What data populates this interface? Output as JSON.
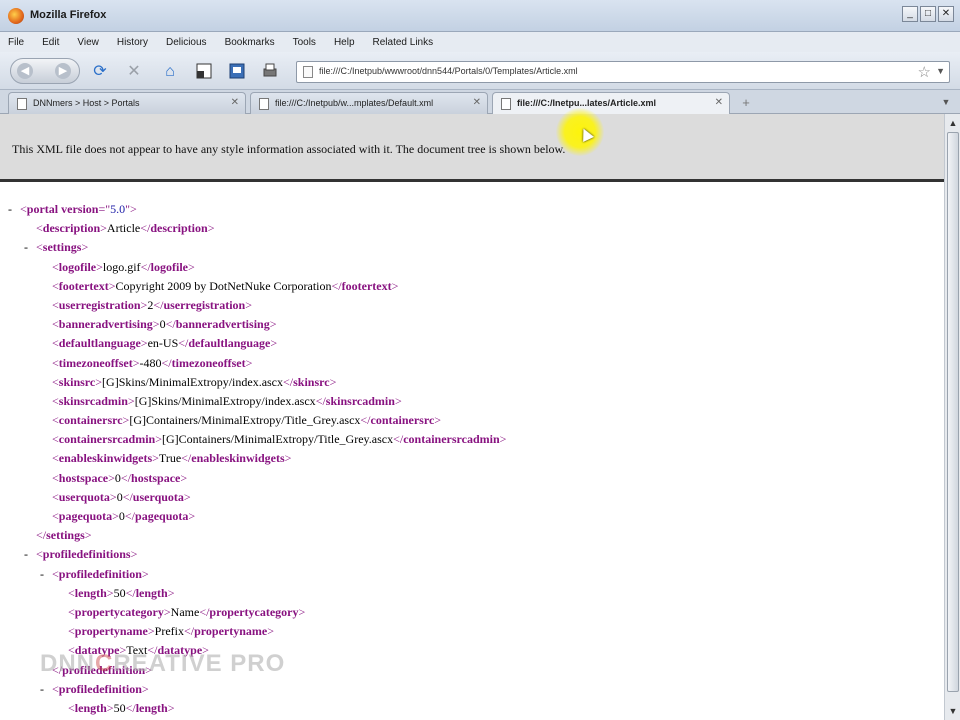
{
  "window": {
    "title": "Mozilla Firefox",
    "buttons": [
      "_",
      "□",
      "✕"
    ]
  },
  "menu": [
    "File",
    "Edit",
    "View",
    "History",
    "Delicious",
    "Bookmarks",
    "Tools",
    "Help",
    "Related Links"
  ],
  "toolbar": {
    "icons": [
      "back-forward-icon",
      "reload-icon",
      "stop-icon",
      "home-icon",
      "page-icon",
      "bookmark-icon",
      "print-icon"
    ],
    "url": "file:///C:/Inetpub/wwwroot/dnn544/Portals/0/Templates/Article.xml"
  },
  "tabs": [
    {
      "label": "DNNmers > Host > Portals",
      "active": false
    },
    {
      "label": "file:///C:/Inetpub/w...mplates/Default.xml",
      "active": false
    },
    {
      "label": "file:///C:/Inetpu...lates/Article.xml",
      "active": true
    }
  ],
  "info_message": "This XML file does not appear to have any style information associated with it. The document tree is shown below.",
  "xml_lines": [
    {
      "indent": 0,
      "toggle": "-",
      "parts": [
        [
          "bracket",
          "<"
        ],
        [
          "tag",
          "portal"
        ],
        [
          "txt",
          " "
        ],
        [
          "attr-name",
          "version"
        ],
        [
          "bracket",
          "=\""
        ],
        [
          "attr-val",
          "5.0"
        ],
        [
          "bracket",
          "\">"
        ]
      ]
    },
    {
      "indent": 1,
      "toggle": "",
      "parts": [
        [
          "bracket",
          "<"
        ],
        [
          "tag",
          "description"
        ],
        [
          "bracket",
          ">"
        ],
        [
          "txt",
          "Article"
        ],
        [
          "bracket",
          "</"
        ],
        [
          "tag",
          "description"
        ],
        [
          "bracket",
          ">"
        ]
      ]
    },
    {
      "indent": 1,
      "toggle": "-",
      "parts": [
        [
          "bracket",
          "<"
        ],
        [
          "tag",
          "settings"
        ],
        [
          "bracket",
          ">"
        ]
      ]
    },
    {
      "indent": 2,
      "toggle": "",
      "parts": [
        [
          "bracket",
          "<"
        ],
        [
          "tag",
          "logofile"
        ],
        [
          "bracket",
          ">"
        ],
        [
          "txt",
          "logo.gif"
        ],
        [
          "bracket",
          "</"
        ],
        [
          "tag",
          "logofile"
        ],
        [
          "bracket",
          ">"
        ]
      ]
    },
    {
      "indent": 2,
      "toggle": "",
      "parts": [
        [
          "bracket",
          "<"
        ],
        [
          "tag",
          "footertext"
        ],
        [
          "bracket",
          ">"
        ],
        [
          "txt",
          "Copyright 2009 by DotNetNuke Corporation"
        ],
        [
          "bracket",
          "</"
        ],
        [
          "tag",
          "footertext"
        ],
        [
          "bracket",
          ">"
        ]
      ]
    },
    {
      "indent": 2,
      "toggle": "",
      "parts": [
        [
          "bracket",
          "<"
        ],
        [
          "tag",
          "userregistration"
        ],
        [
          "bracket",
          ">"
        ],
        [
          "txt",
          "2"
        ],
        [
          "bracket",
          "</"
        ],
        [
          "tag",
          "userregistration"
        ],
        [
          "bracket",
          ">"
        ]
      ]
    },
    {
      "indent": 2,
      "toggle": "",
      "parts": [
        [
          "bracket",
          "<"
        ],
        [
          "tag",
          "banneradvertising"
        ],
        [
          "bracket",
          ">"
        ],
        [
          "txt",
          "0"
        ],
        [
          "bracket",
          "</"
        ],
        [
          "tag",
          "banneradvertising"
        ],
        [
          "bracket",
          ">"
        ]
      ]
    },
    {
      "indent": 2,
      "toggle": "",
      "parts": [
        [
          "bracket",
          "<"
        ],
        [
          "tag",
          "defaultlanguage"
        ],
        [
          "bracket",
          ">"
        ],
        [
          "txt",
          "en-US"
        ],
        [
          "bracket",
          "</"
        ],
        [
          "tag",
          "defaultlanguage"
        ],
        [
          "bracket",
          ">"
        ]
      ]
    },
    {
      "indent": 2,
      "toggle": "",
      "parts": [
        [
          "bracket",
          "<"
        ],
        [
          "tag",
          "timezoneoffset"
        ],
        [
          "bracket",
          ">"
        ],
        [
          "txt",
          "-480"
        ],
        [
          "bracket",
          "</"
        ],
        [
          "tag",
          "timezoneoffset"
        ],
        [
          "bracket",
          ">"
        ]
      ]
    },
    {
      "indent": 2,
      "toggle": "",
      "parts": [
        [
          "bracket",
          "<"
        ],
        [
          "tag",
          "skinsrc"
        ],
        [
          "bracket",
          ">"
        ],
        [
          "txt",
          "[G]Skins/MinimalExtropy/index.ascx"
        ],
        [
          "bracket",
          "</"
        ],
        [
          "tag",
          "skinsrc"
        ],
        [
          "bracket",
          ">"
        ]
      ]
    },
    {
      "indent": 2,
      "toggle": "",
      "parts": [
        [
          "bracket",
          "<"
        ],
        [
          "tag",
          "skinsrcadmin"
        ],
        [
          "bracket",
          ">"
        ],
        [
          "txt",
          "[G]Skins/MinimalExtropy/index.ascx"
        ],
        [
          "bracket",
          "</"
        ],
        [
          "tag",
          "skinsrcadmin"
        ],
        [
          "bracket",
          ">"
        ]
      ]
    },
    {
      "indent": 2,
      "toggle": "",
      "parts": [
        [
          "bracket",
          "<"
        ],
        [
          "tag",
          "containersrc"
        ],
        [
          "bracket",
          ">"
        ],
        [
          "txt",
          "[G]Containers/MinimalExtropy/Title_Grey.ascx"
        ],
        [
          "bracket",
          "</"
        ],
        [
          "tag",
          "containersrc"
        ],
        [
          "bracket",
          ">"
        ]
      ]
    },
    {
      "indent": 2,
      "toggle": "",
      "parts": [
        [
          "bracket",
          "<"
        ],
        [
          "tag",
          "containersrcadmin"
        ],
        [
          "bracket",
          ">"
        ],
        [
          "txt",
          "[G]Containers/MinimalExtropy/Title_Grey.ascx"
        ],
        [
          "bracket",
          "</"
        ],
        [
          "tag",
          "containersrcadmin"
        ],
        [
          "bracket",
          ">"
        ]
      ]
    },
    {
      "indent": 2,
      "toggle": "",
      "parts": [
        [
          "bracket",
          "<"
        ],
        [
          "tag",
          "enableskinwidgets"
        ],
        [
          "bracket",
          ">"
        ],
        [
          "txt",
          "True"
        ],
        [
          "bracket",
          "</"
        ],
        [
          "tag",
          "enableskinwidgets"
        ],
        [
          "bracket",
          ">"
        ]
      ]
    },
    {
      "indent": 2,
      "toggle": "",
      "parts": [
        [
          "bracket",
          "<"
        ],
        [
          "tag",
          "hostspace"
        ],
        [
          "bracket",
          ">"
        ],
        [
          "txt",
          "0"
        ],
        [
          "bracket",
          "</"
        ],
        [
          "tag",
          "hostspace"
        ],
        [
          "bracket",
          ">"
        ]
      ]
    },
    {
      "indent": 2,
      "toggle": "",
      "parts": [
        [
          "bracket",
          "<"
        ],
        [
          "tag",
          "userquota"
        ],
        [
          "bracket",
          ">"
        ],
        [
          "txt",
          "0"
        ],
        [
          "bracket",
          "</"
        ],
        [
          "tag",
          "userquota"
        ],
        [
          "bracket",
          ">"
        ]
      ]
    },
    {
      "indent": 2,
      "toggle": "",
      "parts": [
        [
          "bracket",
          "<"
        ],
        [
          "tag",
          "pagequota"
        ],
        [
          "bracket",
          ">"
        ],
        [
          "txt",
          "0"
        ],
        [
          "bracket",
          "</"
        ],
        [
          "tag",
          "pagequota"
        ],
        [
          "bracket",
          ">"
        ]
      ]
    },
    {
      "indent": 1,
      "toggle": "",
      "parts": [
        [
          "bracket",
          "</"
        ],
        [
          "tag",
          "settings"
        ],
        [
          "bracket",
          ">"
        ]
      ]
    },
    {
      "indent": 1,
      "toggle": "-",
      "parts": [
        [
          "bracket",
          "<"
        ],
        [
          "tag",
          "profiledefinitions"
        ],
        [
          "bracket",
          ">"
        ]
      ]
    },
    {
      "indent": 2,
      "toggle": "-",
      "parts": [
        [
          "bracket",
          "<"
        ],
        [
          "tag",
          "profiledefinition"
        ],
        [
          "bracket",
          ">"
        ]
      ]
    },
    {
      "indent": 3,
      "toggle": "",
      "parts": [
        [
          "bracket",
          "<"
        ],
        [
          "tag",
          "length"
        ],
        [
          "bracket",
          ">"
        ],
        [
          "txt",
          "50"
        ],
        [
          "bracket",
          "</"
        ],
        [
          "tag",
          "length"
        ],
        [
          "bracket",
          ">"
        ]
      ]
    },
    {
      "indent": 3,
      "toggle": "",
      "parts": [
        [
          "bracket",
          "<"
        ],
        [
          "tag",
          "propertycategory"
        ],
        [
          "bracket",
          ">"
        ],
        [
          "txt",
          "Name"
        ],
        [
          "bracket",
          "</"
        ],
        [
          "tag",
          "propertycategory"
        ],
        [
          "bracket",
          ">"
        ]
      ]
    },
    {
      "indent": 3,
      "toggle": "",
      "parts": [
        [
          "bracket",
          "<"
        ],
        [
          "tag",
          "propertyname"
        ],
        [
          "bracket",
          ">"
        ],
        [
          "txt",
          "Prefix"
        ],
        [
          "bracket",
          "</"
        ],
        [
          "tag",
          "propertyname"
        ],
        [
          "bracket",
          ">"
        ]
      ]
    },
    {
      "indent": 3,
      "toggle": "",
      "parts": [
        [
          "bracket",
          "<"
        ],
        [
          "tag",
          "datatype"
        ],
        [
          "bracket",
          ">"
        ],
        [
          "txt",
          "Text"
        ],
        [
          "bracket",
          "</"
        ],
        [
          "tag",
          "datatype"
        ],
        [
          "bracket",
          ">"
        ]
      ]
    },
    {
      "indent": 2,
      "toggle": "",
      "parts": [
        [
          "bracket",
          "</"
        ],
        [
          "tag",
          "profiledefinition"
        ],
        [
          "bracket",
          ">"
        ]
      ]
    },
    {
      "indent": 2,
      "toggle": "-",
      "parts": [
        [
          "bracket",
          "<"
        ],
        [
          "tag",
          "profiledefinition"
        ],
        [
          "bracket",
          ">"
        ]
      ]
    },
    {
      "indent": 3,
      "toggle": "",
      "parts": [
        [
          "bracket",
          "<"
        ],
        [
          "tag",
          "length"
        ],
        [
          "bracket",
          ">"
        ],
        [
          "txt",
          "50"
        ],
        [
          "bracket",
          "</"
        ],
        [
          "tag",
          "length"
        ],
        [
          "bracket",
          ">"
        ]
      ]
    }
  ],
  "watermark": {
    "left": "DNN",
    "mid": "C",
    "right": "REATIVE PRO"
  }
}
